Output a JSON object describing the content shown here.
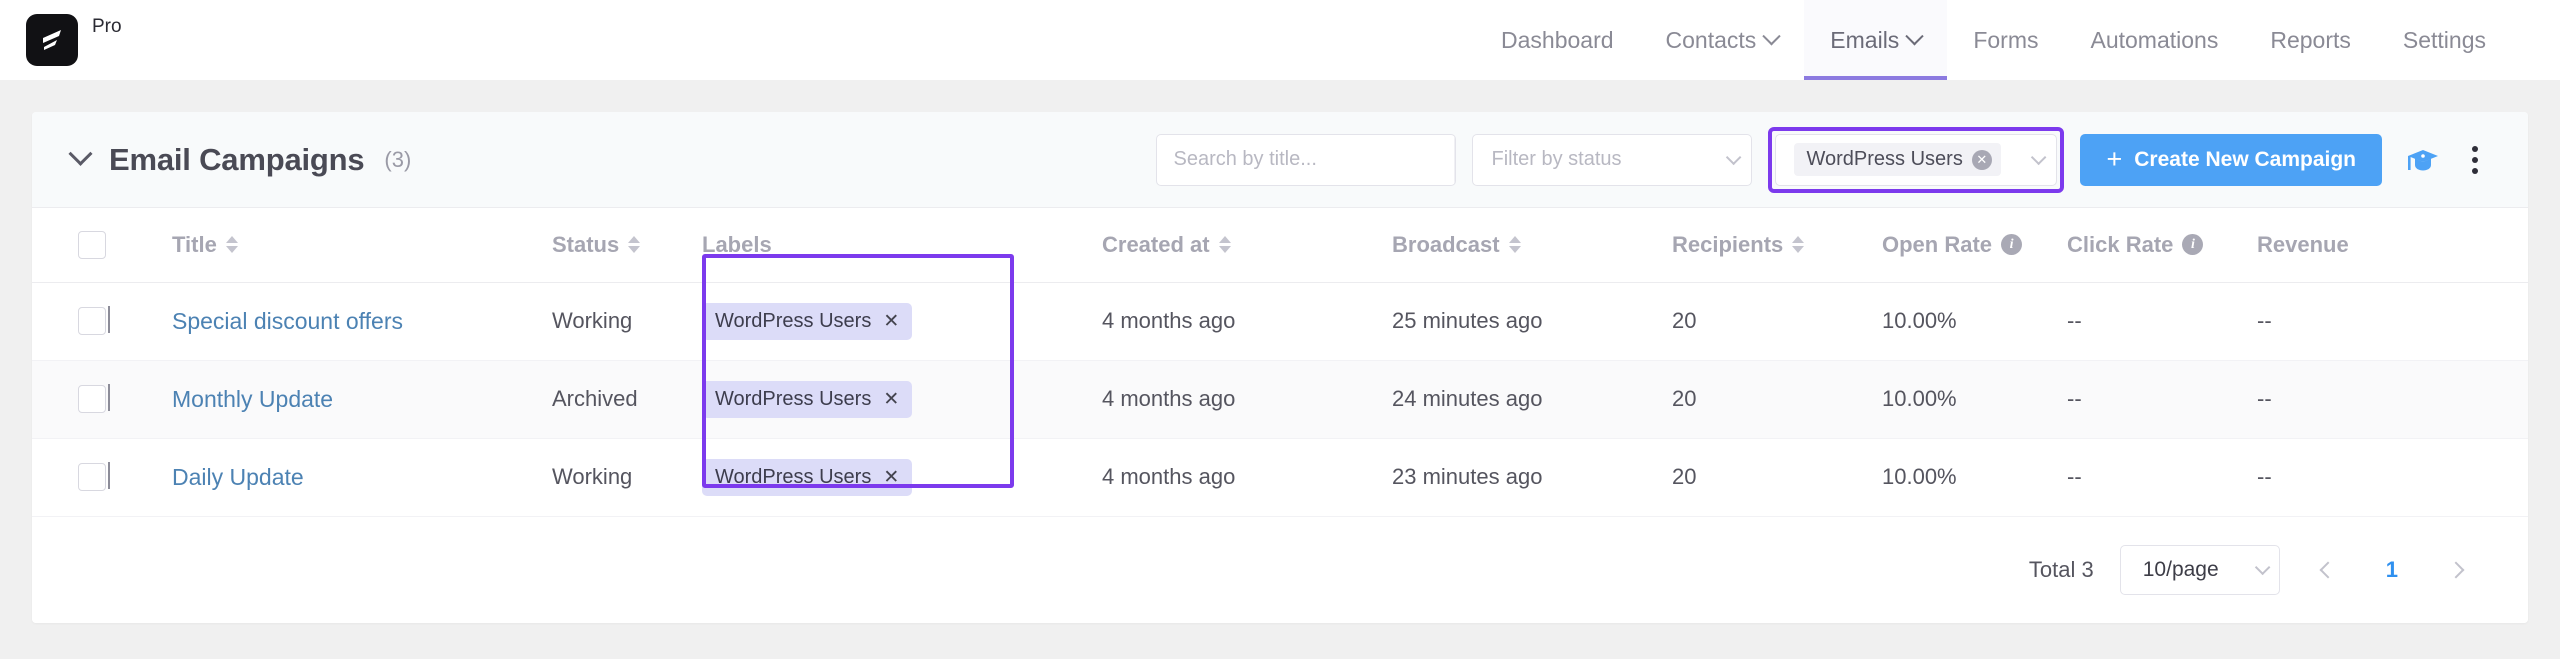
{
  "brand": {
    "tag": "Pro",
    "logo_icon": "lightning-bolt-logo"
  },
  "nav": {
    "items": [
      {
        "label": "Dashboard",
        "has_caret": false,
        "active": false
      },
      {
        "label": "Contacts",
        "has_caret": true,
        "active": false
      },
      {
        "label": "Emails",
        "has_caret": true,
        "active": true
      },
      {
        "label": "Forms",
        "has_caret": false,
        "active": false
      },
      {
        "label": "Automations",
        "has_caret": false,
        "active": false
      },
      {
        "label": "Reports",
        "has_caret": false,
        "active": false
      },
      {
        "label": "Settings",
        "has_caret": false,
        "active": false
      }
    ],
    "active_underline_color": "#8c7ae0"
  },
  "card": {
    "title": "Email Campaigns",
    "count": "(3)",
    "collapse_icon": "chevron-down-icon"
  },
  "toolbar": {
    "search_placeholder": "Search by title...",
    "search_value": "",
    "search_icon": "search-icon",
    "status_filter_placeholder": "Filter by status",
    "label_filter_chip": "WordPress Users",
    "label_filter_clear_icon": "circle-close-icon",
    "create_button": "Create New Campaign",
    "create_button_plus": "+",
    "create_button_color": "#4da2f5",
    "graduation_icon": "graduation-cap-icon",
    "more_icon": "more-vertical-icon",
    "highlight_color": "#7c3aed"
  },
  "table": {
    "columns": [
      {
        "key": "select",
        "label": "",
        "sortable": false,
        "info": false
      },
      {
        "key": "expand",
        "label": "",
        "sortable": false,
        "info": false
      },
      {
        "key": "title",
        "label": "Title",
        "sortable": true,
        "info": false
      },
      {
        "key": "status",
        "label": "Status",
        "sortable": true,
        "info": false
      },
      {
        "key": "labels",
        "label": "Labels",
        "sortable": false,
        "info": false
      },
      {
        "key": "created_at",
        "label": "Created at",
        "sortable": true,
        "info": false
      },
      {
        "key": "broadcast",
        "label": "Broadcast",
        "sortable": true,
        "info": false
      },
      {
        "key": "recipients",
        "label": "Recipients",
        "sortable": true,
        "info": false
      },
      {
        "key": "open_rate",
        "label": "Open Rate",
        "sortable": false,
        "info": true
      },
      {
        "key": "click_rate",
        "label": "Click Rate",
        "sortable": false,
        "info": true
      },
      {
        "key": "revenue",
        "label": "Revenue",
        "sortable": false,
        "info": false
      }
    ],
    "rows": [
      {
        "title": "Special discount offers",
        "status": "Working",
        "label": "WordPress Users",
        "created_at": "4 months ago",
        "broadcast": "25 minutes ago",
        "recipients": "20",
        "open_rate": "10.00%",
        "click_rate": "--",
        "revenue": "--"
      },
      {
        "title": "Monthly Update",
        "status": "Archived",
        "label": "WordPress Users",
        "created_at": "4 months ago",
        "broadcast": "24 minutes ago",
        "recipients": "20",
        "open_rate": "10.00%",
        "click_rate": "--",
        "revenue": "--"
      },
      {
        "title": "Daily Update",
        "status": "Working",
        "label": "WordPress Users",
        "created_at": "4 months ago",
        "broadcast": "23 minutes ago",
        "recipients": "20",
        "open_rate": "10.00%",
        "click_rate": "--",
        "revenue": "--"
      }
    ],
    "label_chip_close_icon": "close-icon",
    "label_chip_bg": "#dcdcf8",
    "row_link_color": "#4c82b3"
  },
  "footer": {
    "total": "Total 3",
    "page_size": "10/page",
    "current_page": "1",
    "prev_icon": "chevron-left-icon",
    "next_icon": "chevron-right-icon",
    "active_page_color": "#2f90ef"
  }
}
